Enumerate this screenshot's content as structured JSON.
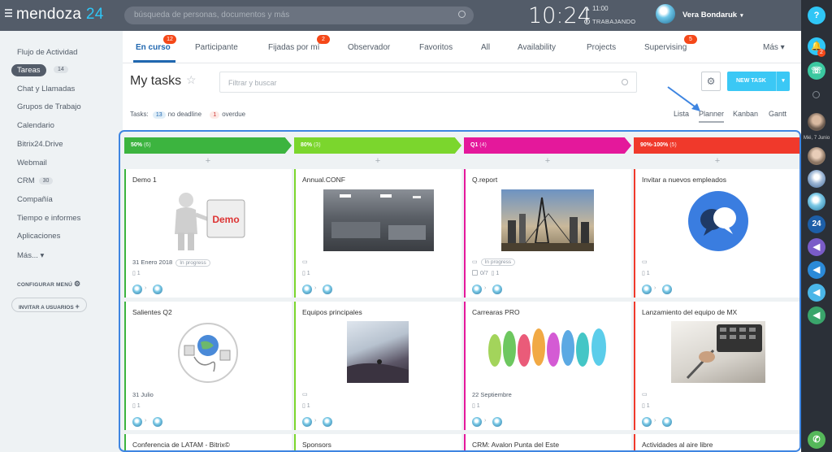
{
  "topbar": {
    "brand_name": "mendoza",
    "brand_num": "24",
    "search_placeholder": "búsqueda de personas, documentos y más",
    "clock": "10:24",
    "alarm": "▲ 11:00",
    "work_status": "TRABAJANDO",
    "user_name": "Vera Bondaruk"
  },
  "sidebar": {
    "items": [
      {
        "label": "Flujo de Actividad"
      },
      {
        "label": "Tareas",
        "count": "14"
      },
      {
        "label": "Chat y Llamadas"
      },
      {
        "label": "Grupos de Trabajo"
      },
      {
        "label": "Calendario"
      },
      {
        "label": "Bitrix24.Drive"
      },
      {
        "label": "Webmail"
      },
      {
        "label": "CRM",
        "count": "30"
      },
      {
        "label": "Compañía"
      },
      {
        "label": "Tiempo e informes"
      },
      {
        "label": "Aplicaciones"
      },
      {
        "label": "Más... ▾"
      }
    ],
    "configure": "CONFIGURAR MENÚ",
    "invite": "INVITAR A USUARIOS"
  },
  "tabs": [
    {
      "label": "En curso",
      "badge": "12"
    },
    {
      "label": "Participante"
    },
    {
      "label": "Fijadas por mí",
      "badge": "2"
    },
    {
      "label": "Observador"
    },
    {
      "label": "Favoritos"
    },
    {
      "label": "All"
    },
    {
      "label": "Availability"
    },
    {
      "label": "Projects"
    },
    {
      "label": "Supervising",
      "badge": "5"
    },
    {
      "label": "Más ▾"
    }
  ],
  "toolbar": {
    "title": "My tasks",
    "filter_placeholder": "Filtrar y buscar",
    "new_task": "NEW TASK"
  },
  "stats": {
    "label": "Tasks:",
    "no_deadline_count": "13",
    "no_deadline": "no deadline",
    "overdue_count": "1",
    "overdue": "overdue"
  },
  "views": [
    "Lista",
    "Planner",
    "Kanban",
    "Gantt"
  ],
  "rightbar": {
    "help": "?",
    "bell_badge": "2",
    "date": "Mié, 7 Junio",
    "b24": "24"
  },
  "columns": [
    {
      "title": "50%",
      "count": "(6)",
      "color": "#3cb43f",
      "cards": [
        {
          "title": "Demo 1",
          "date": "31 Enero 2018",
          "status": "In progress",
          "checklist": "",
          "files": "1"
        },
        {
          "title": "Salientes Q2",
          "date": "31 Julio",
          "status": "",
          "checklist": "",
          "files": "1"
        },
        {
          "title": "Conferencia de LATAM - Bitrix©"
        }
      ]
    },
    {
      "title": "80%",
      "count": "(3)",
      "color": "#7bd62d",
      "cards": [
        {
          "title": "Annual.CONF",
          "date": "",
          "status": "",
          "checklist": "",
          "files": "1"
        },
        {
          "title": "Equipos principales",
          "date": "",
          "status": "",
          "checklist": "",
          "files": "1"
        },
        {
          "title": "Sponsors"
        }
      ]
    },
    {
      "title": "Q1",
      "count": "(4)",
      "color": "#e4189b",
      "cards": [
        {
          "title": "Q.report",
          "date": "",
          "status": "In progress",
          "checklist": "0/7",
          "files": "1"
        },
        {
          "title": "Carrearas PRO",
          "date": "22 Septiembre",
          "status": "",
          "checklist": "",
          "files": "1"
        },
        {
          "title": "CRM: Avalon Punta del Este"
        }
      ]
    },
    {
      "title": "90%-100%",
      "count": "(5)",
      "color": "#f0392b",
      "cards": [
        {
          "title": "Invitar a nuevos empleados",
          "date": "",
          "status": "",
          "checklist": "",
          "files": "1"
        },
        {
          "title": "Lanzamiento del equipo de MX",
          "date": "",
          "status": "",
          "checklist": "",
          "files": "1"
        },
        {
          "title": "Actividades al aire libre"
        }
      ]
    }
  ],
  "images": {
    "demo_label": "Demo"
  }
}
